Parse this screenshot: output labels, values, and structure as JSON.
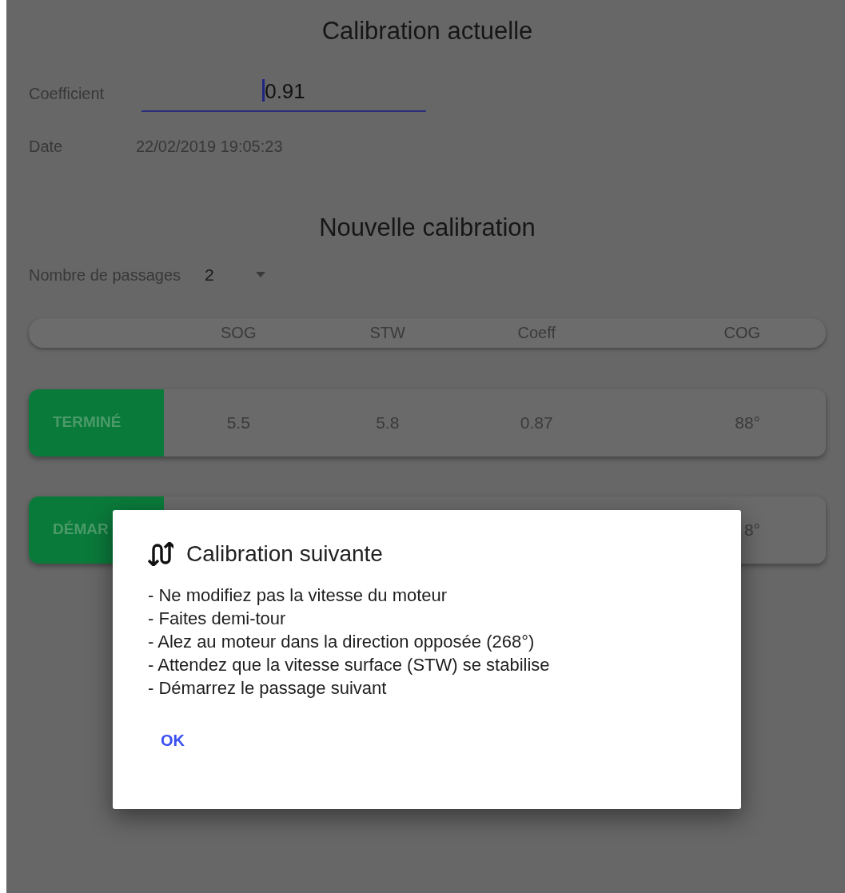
{
  "current": {
    "title": "Calibration actuelle",
    "fields": [
      {
        "label": "Coefficient",
        "kind": "input",
        "value": "0.91",
        "focused": true
      },
      {
        "label": "Date",
        "kind": "text",
        "value": "22/02/2019 19:05:23"
      }
    ]
  },
  "new": {
    "title": "Nouvelle calibration",
    "passes": {
      "label": "Nombre de passages",
      "value": "2"
    },
    "columns": [
      "SOG",
      "STW",
      "Coeff",
      "COG"
    ],
    "rows": [
      {
        "button": "TERMINÉ",
        "cells": [
          "5.5",
          "5.8",
          "0.87",
          "88°"
        ]
      },
      {
        "button": "DÉMAR",
        "cells": [
          null,
          null,
          null,
          "8°"
        ]
      }
    ]
  },
  "dialog": {
    "title": "Calibration suivante",
    "lines": [
      "- Ne modifiez pas la vitesse du moteur",
      "- Faites demi-tour",
      "- Alez au moteur dans la direction opposée (268°)",
      "- Attendez que la vitesse surface (STW) se stabilise",
      "- Démarrez le passage suivant"
    ],
    "button": "OK"
  }
}
